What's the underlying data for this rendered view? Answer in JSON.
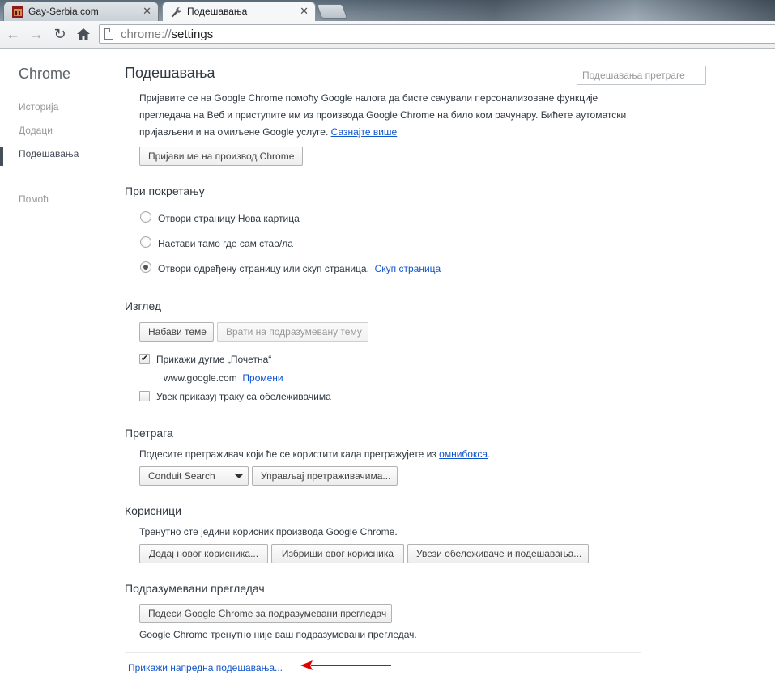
{
  "tabs": [
    {
      "title": "Gay-Serbia.com",
      "favicon": "site-favicon",
      "active": false
    },
    {
      "title": "Подешавања",
      "favicon": "wrench-icon",
      "active": true
    }
  ],
  "toolbar": {
    "url_scheme": "chrome://",
    "url_path": "settings"
  },
  "sidebar": {
    "brand": "Chrome",
    "items": [
      {
        "label": "Историја",
        "selected": false
      },
      {
        "label": "Додаци",
        "selected": false
      },
      {
        "label": "Подешавања",
        "selected": true
      },
      {
        "label": "Помоћ",
        "selected": false
      }
    ]
  },
  "main": {
    "title": "Подешавања",
    "search_placeholder": "Подешавања претраге",
    "signin": {
      "line1": "Пријавите се на Google Chrome помоћу Google налога да бисте сачували персонализоване функције",
      "line2": "прегледача на Веб и приступите им из производа Google Chrome на било ком рачунару. Бићете аутоматски",
      "line3": "пријављени и на омиљене Google услуге.",
      "learn_more": "Сазнајте више",
      "button": "Пријави ме на производ Chrome"
    },
    "startup": {
      "title": "При покретању",
      "options": [
        {
          "label": "Отвори страницу Нова картица",
          "checked": false
        },
        {
          "label": "Настави тамо где сам стао/ла",
          "checked": false
        },
        {
          "label": "Отвори одређену страницу или скуп страница.",
          "checked": true
        }
      ],
      "set_pages_link": "Скуп страница"
    },
    "appearance": {
      "title": "Изглед",
      "get_themes": "Набави теме",
      "reset_theme": "Врати на подразумевану тему",
      "show_home": "Прикажи дугме „Почетна“",
      "show_home_checked": true,
      "home_url": "www.google.com",
      "change_link": "Промени",
      "show_bookmarks": "Увек приказуј траку са обележивачима",
      "show_bookmarks_checked": false
    },
    "search": {
      "title": "Претрага",
      "description": "Подесите претраживач који ће се користити када претражујете из",
      "omnibox_link": "омнибокса",
      "engine": "Conduit Search",
      "manage": "Управљај претраживачима..."
    },
    "users": {
      "title": "Корисници",
      "description": "Тренутно сте једини корисник производа Google Chrome.",
      "add": "Додај новог корисника...",
      "delete": "Избриши овог корисника",
      "import": "Увези обележиваче и подешавања..."
    },
    "default_browser": {
      "title": "Подразумевани прегледач",
      "button": "Подеси Google Chrome за подразумевани прегледач",
      "status": "Google Chrome тренутно није ваш подразумевани прегледач."
    },
    "advanced_link": "Прикажи напредна подешавања...",
    "annotation_color": "#e00000"
  }
}
